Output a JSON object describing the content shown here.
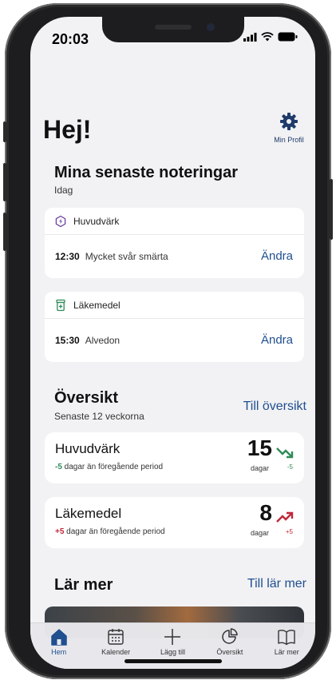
{
  "status_bar": {
    "time": "20:03"
  },
  "header": {
    "greeting": "Hej!",
    "profile_label": "Min Profil",
    "profile_icon": "gear-icon"
  },
  "recent": {
    "title": "Mina senaste noteringar",
    "subtitle": "Idag",
    "cards": [
      {
        "category": "Huvudvärk",
        "icon": "headache-icon",
        "time": "12:30",
        "text": "Mycket svår smärta",
        "action": "Ändra"
      },
      {
        "category": "Läkemedel",
        "icon": "medicine-icon",
        "time": "15:30",
        "text": "Alvedon",
        "action": "Ändra"
      }
    ]
  },
  "overview": {
    "title": "Översikt",
    "subtitle": "Senaste 12 veckorna",
    "link": "Till översikt",
    "stats": [
      {
        "name": "Huvudvärk",
        "delta_value": "-5",
        "delta_text": " dagar än föregående period",
        "number": "15",
        "unit": "dagar",
        "trend": "down",
        "trend_value": "-5",
        "color": "#2e8b57"
      },
      {
        "name": "Läkemedel",
        "delta_value": "+5",
        "delta_text": " dagar än föregående period",
        "number": "8",
        "unit": "dagar",
        "trend": "up",
        "trend_value": "+5",
        "color": "#c0283a"
      }
    ]
  },
  "learn": {
    "title": "Lär mer",
    "link": "Till lär mer"
  },
  "tabbar": {
    "items": [
      {
        "label": "Hem",
        "icon": "home-icon",
        "active": true
      },
      {
        "label": "Kalender",
        "icon": "calendar-icon",
        "active": false
      },
      {
        "label": "Lägg till",
        "icon": "plus-icon",
        "active": false
      },
      {
        "label": "Översikt",
        "icon": "pie-chart-icon",
        "active": false
      },
      {
        "label": "Lär mer",
        "icon": "book-icon",
        "active": false
      }
    ]
  },
  "colors": {
    "accent": "#1f4f8f",
    "background": "#f2f2f4",
    "positive": "#2e8b57",
    "negative": "#c0283a"
  }
}
